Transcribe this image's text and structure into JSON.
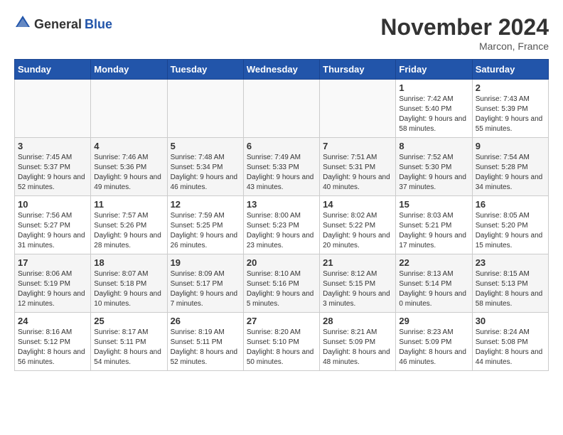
{
  "header": {
    "logo_general": "General",
    "logo_blue": "Blue",
    "month_title": "November 2024",
    "location": "Marcon, France"
  },
  "weekdays": [
    "Sunday",
    "Monday",
    "Tuesday",
    "Wednesday",
    "Thursday",
    "Friday",
    "Saturday"
  ],
  "weeks": [
    [
      {
        "day": "",
        "info": ""
      },
      {
        "day": "",
        "info": ""
      },
      {
        "day": "",
        "info": ""
      },
      {
        "day": "",
        "info": ""
      },
      {
        "day": "",
        "info": ""
      },
      {
        "day": "1",
        "info": "Sunrise: 7:42 AM\nSunset: 5:40 PM\nDaylight: 9 hours and 58 minutes."
      },
      {
        "day": "2",
        "info": "Sunrise: 7:43 AM\nSunset: 5:39 PM\nDaylight: 9 hours and 55 minutes."
      }
    ],
    [
      {
        "day": "3",
        "info": "Sunrise: 7:45 AM\nSunset: 5:37 PM\nDaylight: 9 hours and 52 minutes."
      },
      {
        "day": "4",
        "info": "Sunrise: 7:46 AM\nSunset: 5:36 PM\nDaylight: 9 hours and 49 minutes."
      },
      {
        "day": "5",
        "info": "Sunrise: 7:48 AM\nSunset: 5:34 PM\nDaylight: 9 hours and 46 minutes."
      },
      {
        "day": "6",
        "info": "Sunrise: 7:49 AM\nSunset: 5:33 PM\nDaylight: 9 hours and 43 minutes."
      },
      {
        "day": "7",
        "info": "Sunrise: 7:51 AM\nSunset: 5:31 PM\nDaylight: 9 hours and 40 minutes."
      },
      {
        "day": "8",
        "info": "Sunrise: 7:52 AM\nSunset: 5:30 PM\nDaylight: 9 hours and 37 minutes."
      },
      {
        "day": "9",
        "info": "Sunrise: 7:54 AM\nSunset: 5:28 PM\nDaylight: 9 hours and 34 minutes."
      }
    ],
    [
      {
        "day": "10",
        "info": "Sunrise: 7:56 AM\nSunset: 5:27 PM\nDaylight: 9 hours and 31 minutes."
      },
      {
        "day": "11",
        "info": "Sunrise: 7:57 AM\nSunset: 5:26 PM\nDaylight: 9 hours and 28 minutes."
      },
      {
        "day": "12",
        "info": "Sunrise: 7:59 AM\nSunset: 5:25 PM\nDaylight: 9 hours and 26 minutes."
      },
      {
        "day": "13",
        "info": "Sunrise: 8:00 AM\nSunset: 5:23 PM\nDaylight: 9 hours and 23 minutes."
      },
      {
        "day": "14",
        "info": "Sunrise: 8:02 AM\nSunset: 5:22 PM\nDaylight: 9 hours and 20 minutes."
      },
      {
        "day": "15",
        "info": "Sunrise: 8:03 AM\nSunset: 5:21 PM\nDaylight: 9 hours and 17 minutes."
      },
      {
        "day": "16",
        "info": "Sunrise: 8:05 AM\nSunset: 5:20 PM\nDaylight: 9 hours and 15 minutes."
      }
    ],
    [
      {
        "day": "17",
        "info": "Sunrise: 8:06 AM\nSunset: 5:19 PM\nDaylight: 9 hours and 12 minutes."
      },
      {
        "day": "18",
        "info": "Sunrise: 8:07 AM\nSunset: 5:18 PM\nDaylight: 9 hours and 10 minutes."
      },
      {
        "day": "19",
        "info": "Sunrise: 8:09 AM\nSunset: 5:17 PM\nDaylight: 9 hours and 7 minutes."
      },
      {
        "day": "20",
        "info": "Sunrise: 8:10 AM\nSunset: 5:16 PM\nDaylight: 9 hours and 5 minutes."
      },
      {
        "day": "21",
        "info": "Sunrise: 8:12 AM\nSunset: 5:15 PM\nDaylight: 9 hours and 3 minutes."
      },
      {
        "day": "22",
        "info": "Sunrise: 8:13 AM\nSunset: 5:14 PM\nDaylight: 9 hours and 0 minutes."
      },
      {
        "day": "23",
        "info": "Sunrise: 8:15 AM\nSunset: 5:13 PM\nDaylight: 8 hours and 58 minutes."
      }
    ],
    [
      {
        "day": "24",
        "info": "Sunrise: 8:16 AM\nSunset: 5:12 PM\nDaylight: 8 hours and 56 minutes."
      },
      {
        "day": "25",
        "info": "Sunrise: 8:17 AM\nSunset: 5:11 PM\nDaylight: 8 hours and 54 minutes."
      },
      {
        "day": "26",
        "info": "Sunrise: 8:19 AM\nSunset: 5:11 PM\nDaylight: 8 hours and 52 minutes."
      },
      {
        "day": "27",
        "info": "Sunrise: 8:20 AM\nSunset: 5:10 PM\nDaylight: 8 hours and 50 minutes."
      },
      {
        "day": "28",
        "info": "Sunrise: 8:21 AM\nSunset: 5:09 PM\nDaylight: 8 hours and 48 minutes."
      },
      {
        "day": "29",
        "info": "Sunrise: 8:23 AM\nSunset: 5:09 PM\nDaylight: 8 hours and 46 minutes."
      },
      {
        "day": "30",
        "info": "Sunrise: 8:24 AM\nSunset: 5:08 PM\nDaylight: 8 hours and 44 minutes."
      }
    ]
  ]
}
